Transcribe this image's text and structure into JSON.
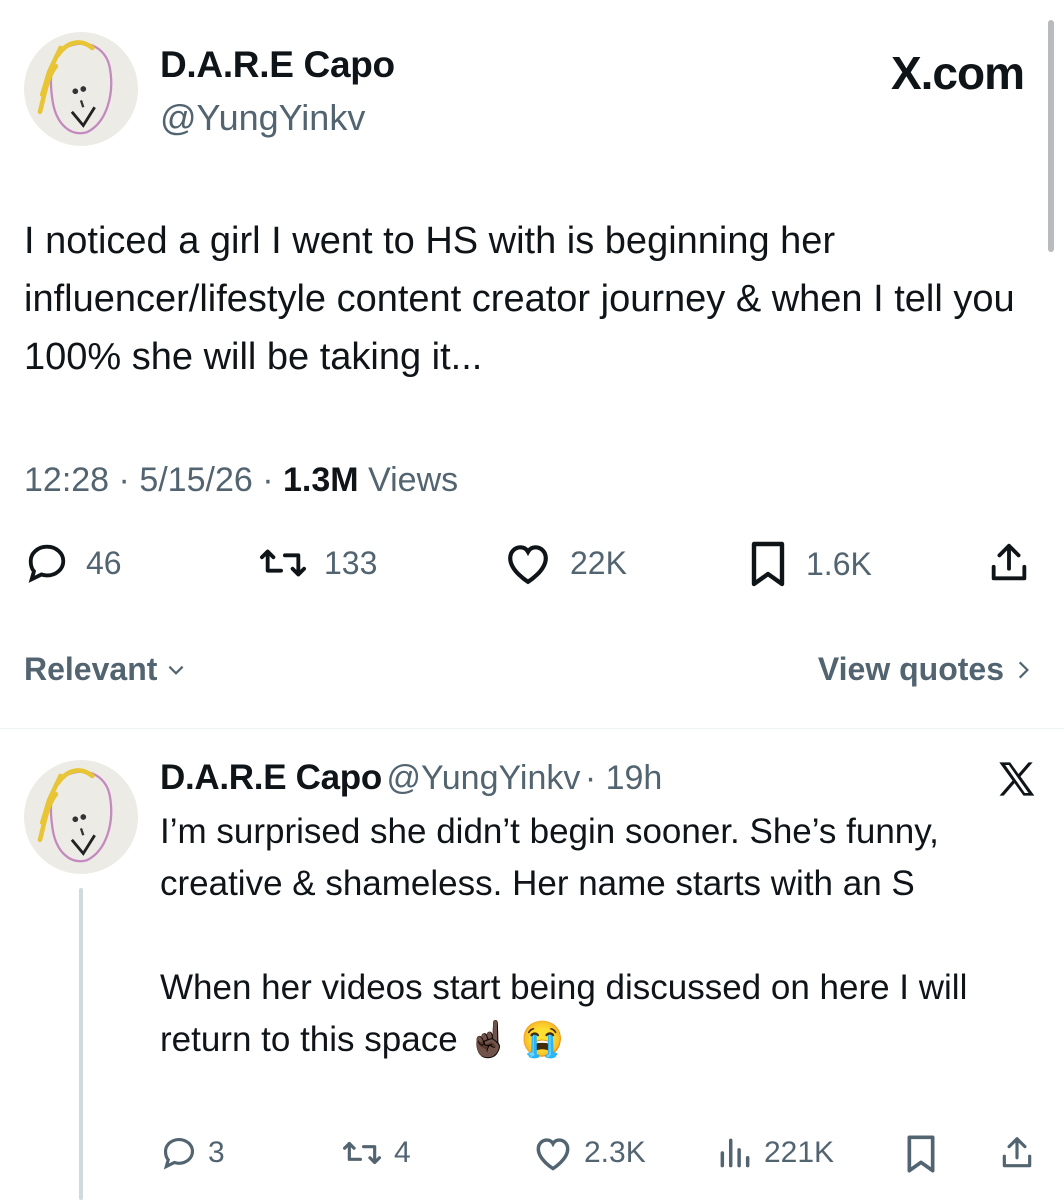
{
  "header": {
    "display_name": "D.A.R.E Capo",
    "handle": "@YungYinkv",
    "site_label": "X.com"
  },
  "tweet": {
    "text": "I noticed a girl I went to HS with is beginning her influencer/lifestyle content creator journey & when I tell you 100% she will be taking it...",
    "time": "12:28",
    "date": "5/15/26",
    "views_count": "1.3M",
    "views_label": "Views",
    "replies": "46",
    "reposts": "133",
    "likes": "22K",
    "bookmarks": "1.6K"
  },
  "sort_bar": {
    "sort_label": "Relevant",
    "quotes_label": "View quotes"
  },
  "reply": {
    "display_name": "D.A.R.E Capo",
    "handle": "@YungYinkv",
    "age": "19h",
    "text": "I’m surprised she didn’t begin sooner. She’s funny, creative & shameless. Her name starts with an S\n\nWhen her videos start being discussed on here I will return to this space ☝🏿 😭",
    "replies": "3",
    "reposts": "4",
    "likes": "2.3K",
    "views": "221K"
  },
  "icons": {
    "reply": "comment-icon",
    "repost": "repost-icon",
    "like": "heart-icon",
    "bookmark": "bookmark-icon",
    "share": "share-icon",
    "views": "bar-chart-icon",
    "logo": "x-logo-icon"
  },
  "colors": {
    "text": "#0f1419",
    "secondary": "#536471",
    "divider": "#eff3f4"
  }
}
